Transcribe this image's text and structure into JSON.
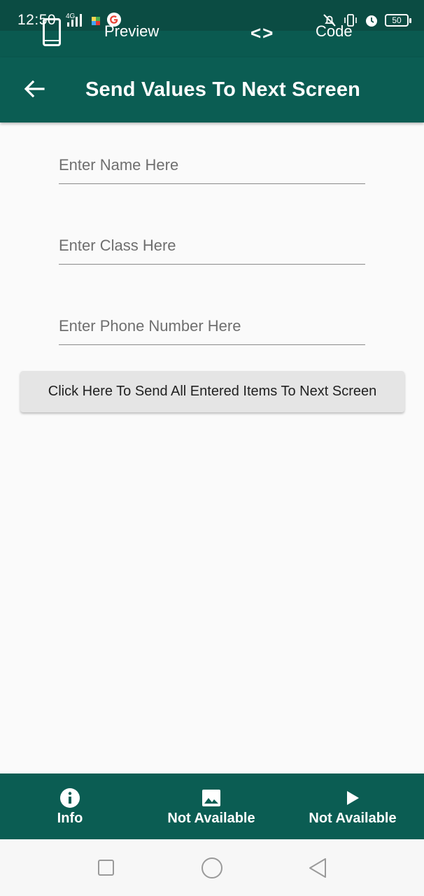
{
  "status_bar": {
    "time": "12:50",
    "network": "4G",
    "battery": "50"
  },
  "preview_header": {
    "preview_label": "Preview",
    "code_label": "Code"
  },
  "app_bar": {
    "title": "Send Values To Next Screen"
  },
  "form": {
    "name_placeholder": "Enter Name Here",
    "class_placeholder": "Enter Class Here",
    "phone_placeholder": "Enter Phone Number Here",
    "send_button_label": "Click Here To Send All Entered Items To Next Screen"
  },
  "bottom_nav": {
    "items": [
      {
        "label": "Info",
        "icon": "info-icon"
      },
      {
        "label": "Not Available",
        "icon": "image-icon"
      },
      {
        "label": "Not Available",
        "icon": "play-icon"
      }
    ]
  },
  "colors": {
    "primary": "#0b5d53",
    "primary_dark": "#0b4c43",
    "button_bg": "#e5e5e5",
    "background": "#fafafa"
  }
}
